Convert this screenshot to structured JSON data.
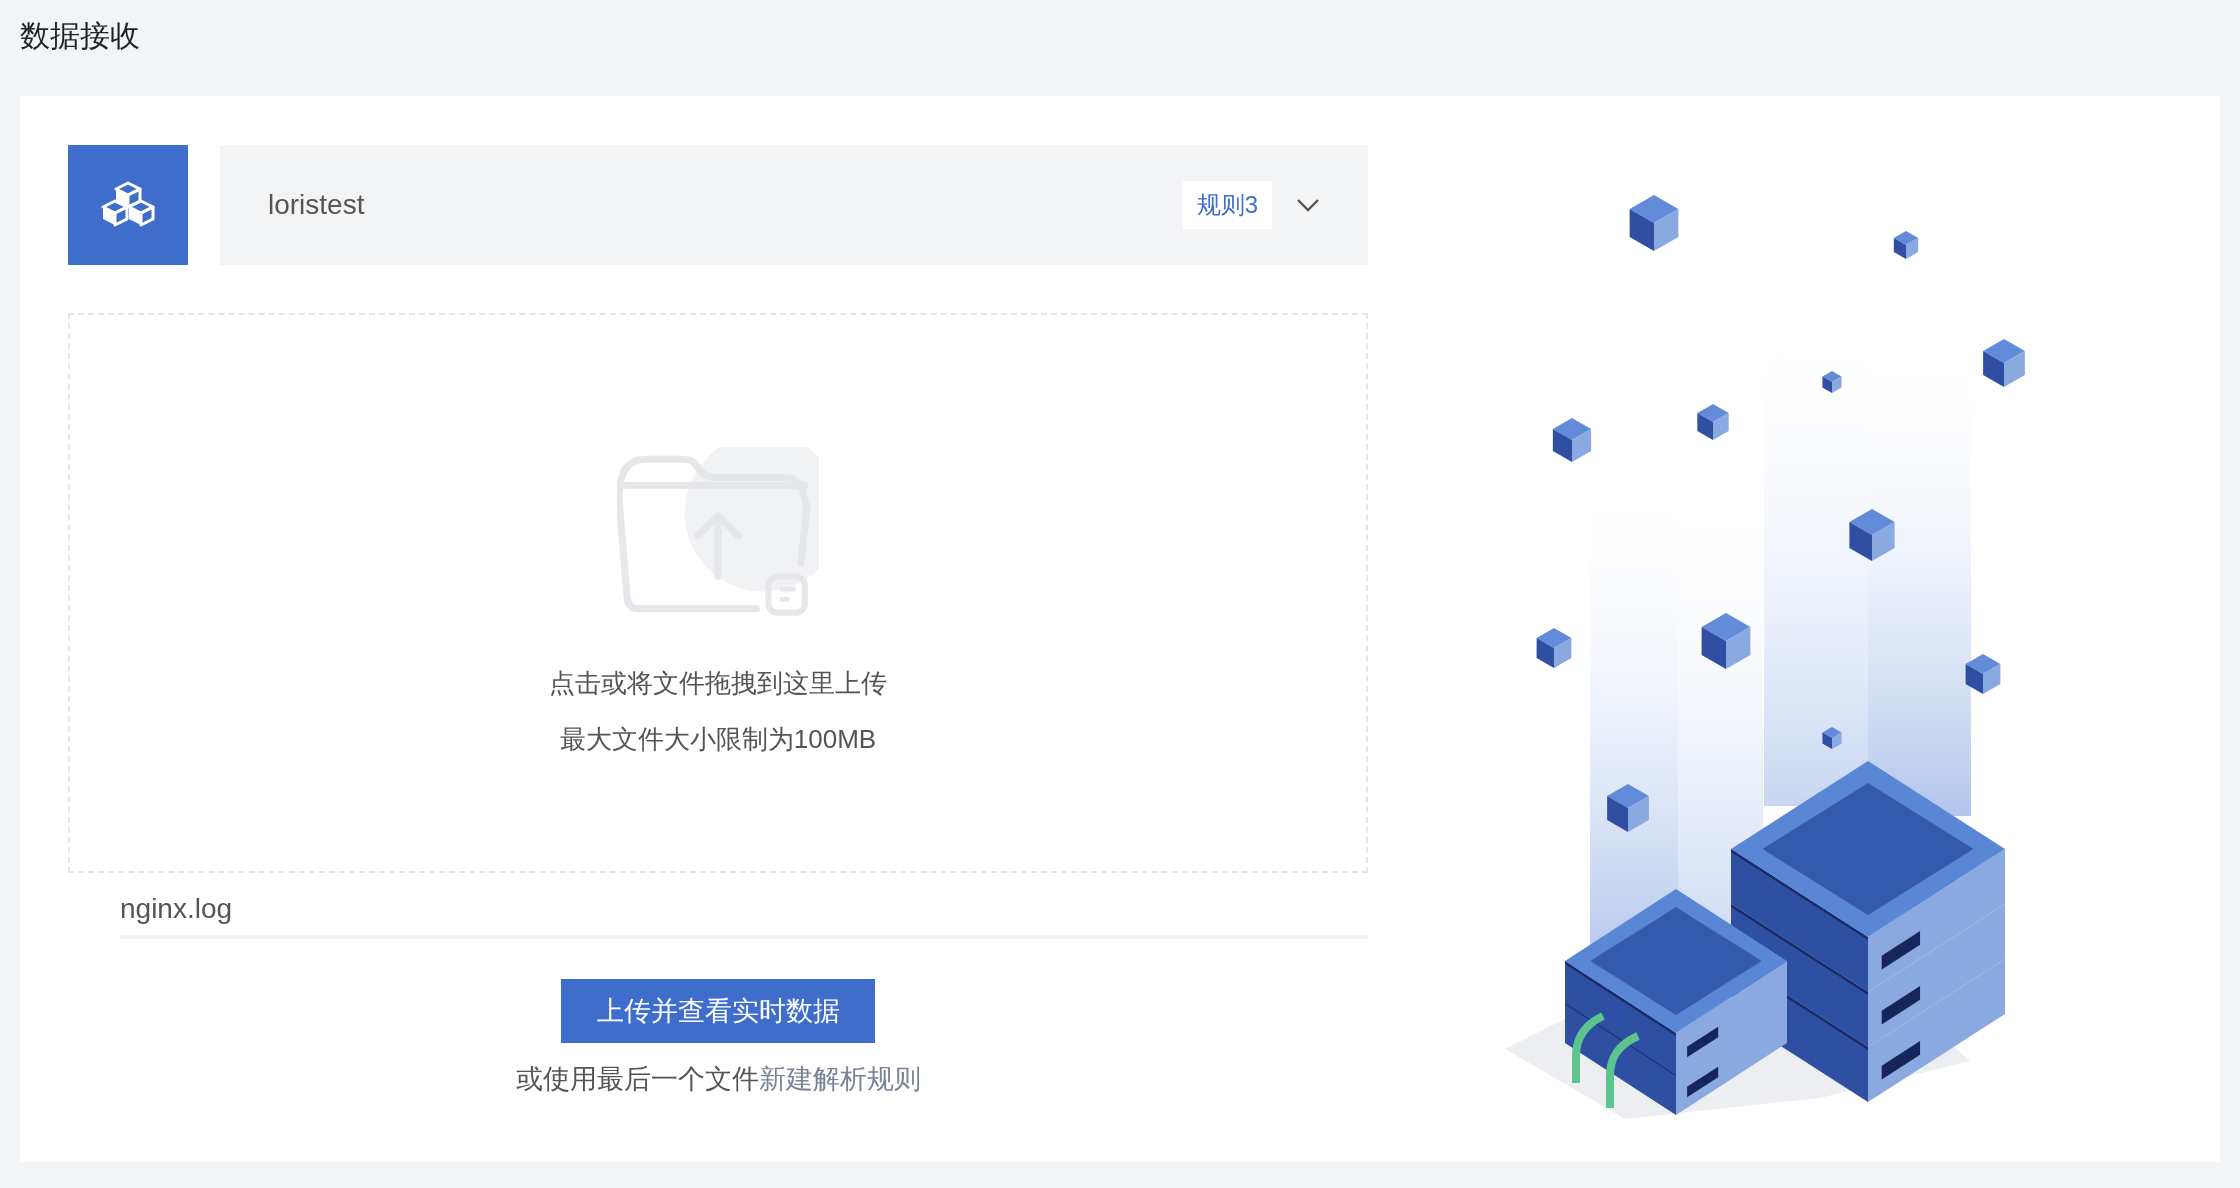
{
  "title": "数据接收",
  "source": {
    "name": "loristest",
    "rule_tag": "规则3"
  },
  "upload": {
    "hint": "点击或将文件拖拽到这里上传",
    "limit": "最大文件大小限制为100MB"
  },
  "file": {
    "value": "nginx.log"
  },
  "primary_button": "上传并查看实时数据",
  "footer": {
    "text": "或使用最后一个文件",
    "link": "新建解析规则"
  }
}
